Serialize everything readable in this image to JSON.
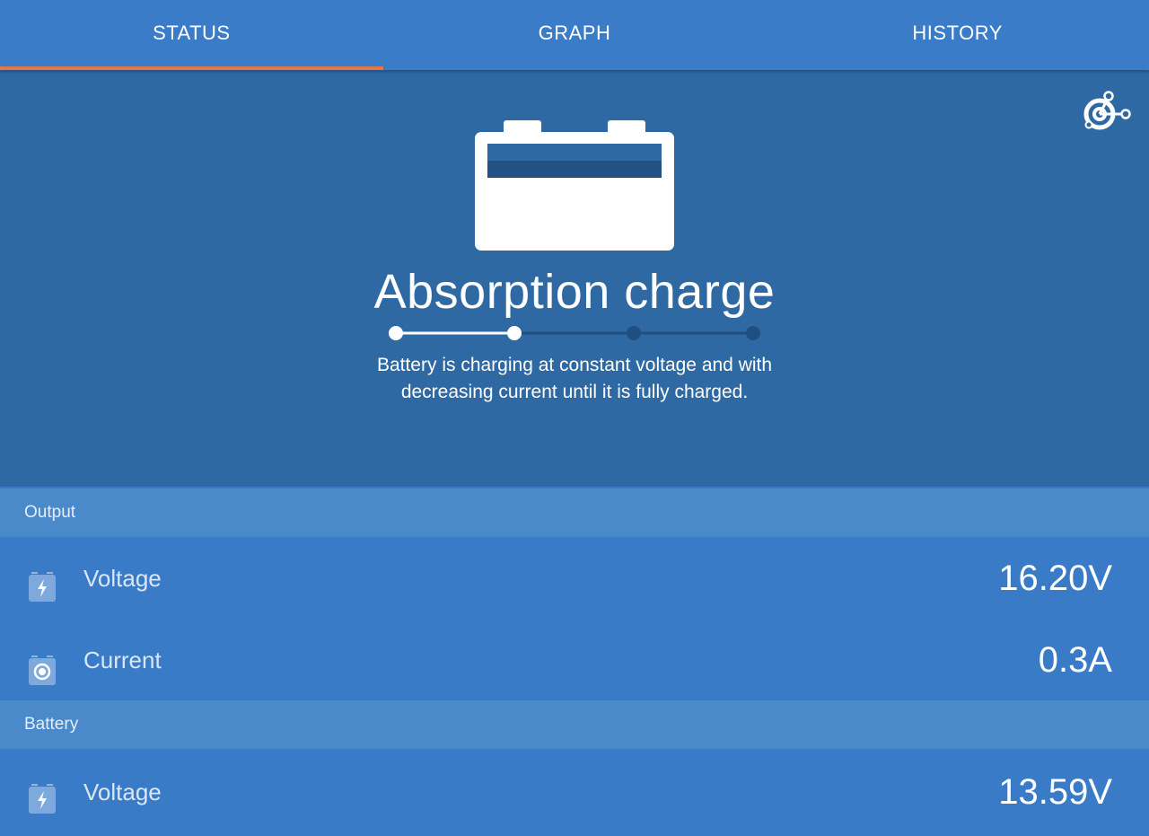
{
  "tabs": [
    {
      "label": "STATUS",
      "active": true
    },
    {
      "label": "GRAPH",
      "active": false
    },
    {
      "label": "HISTORY",
      "active": false
    }
  ],
  "hero": {
    "state_title": "Absorption charge",
    "state_description_line1": "Battery is charging at constant voltage and with",
    "state_description_line2": "decreasing current until it is fully charged.",
    "progress": {
      "steps": 4,
      "current_step": 2
    },
    "icons": [
      "battery-icon",
      "bluetooth-connect-icon"
    ]
  },
  "sections": {
    "output": {
      "title": "Output",
      "voltage_label": "Voltage",
      "voltage_value": "16.20V",
      "current_label": "Current",
      "current_value": "0.3A"
    },
    "battery": {
      "title": "Battery",
      "voltage_label": "Voltage",
      "voltage_value": "13.59V"
    }
  },
  "colors": {
    "tab_bar": "#3b7cc9",
    "tab_active_indicator": "#e9744b",
    "hero_background": "#2f69a4",
    "section_header": "#4b8aca",
    "row_background": "#3a7bc8",
    "progress_inactive": "#1f4f80"
  }
}
